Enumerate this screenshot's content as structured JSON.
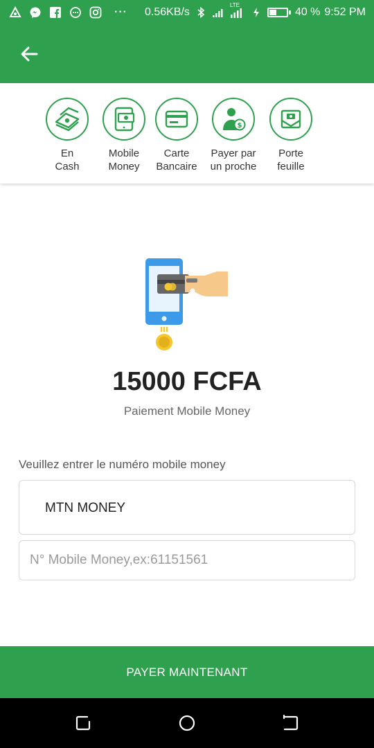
{
  "status_bar": {
    "net_speed": "0.56KB/s",
    "lte": "LTE",
    "battery_percent": "40 %",
    "battery_level": 0.4,
    "time": "9:52 PM",
    "dots": "···"
  },
  "payment_methods": [
    {
      "label": "En\nCash",
      "icon": "cash-icon"
    },
    {
      "label": "Mobile\nMoney",
      "icon": "mobile-money-icon"
    },
    {
      "label": "Carte\nBancaire",
      "icon": "bank-card-icon"
    },
    {
      "label": "Payer par\nun proche",
      "icon": "person-pay-icon"
    },
    {
      "label": "Porte\nfeuille",
      "icon": "wallet-icon"
    }
  ],
  "payment": {
    "amount": "15000 FCFA",
    "subtitle": "Paiement Mobile Money"
  },
  "form": {
    "prompt": "Veuillez entrer le numéro mobile money",
    "operator": "MTN MONEY",
    "phone_placeholder": "N° Mobile Money,ex:61151561",
    "phone_value": ""
  },
  "pay_button": "PAYER MAINTENANT",
  "colors": {
    "primary": "#2ea04e",
    "navbar": "#000000"
  }
}
